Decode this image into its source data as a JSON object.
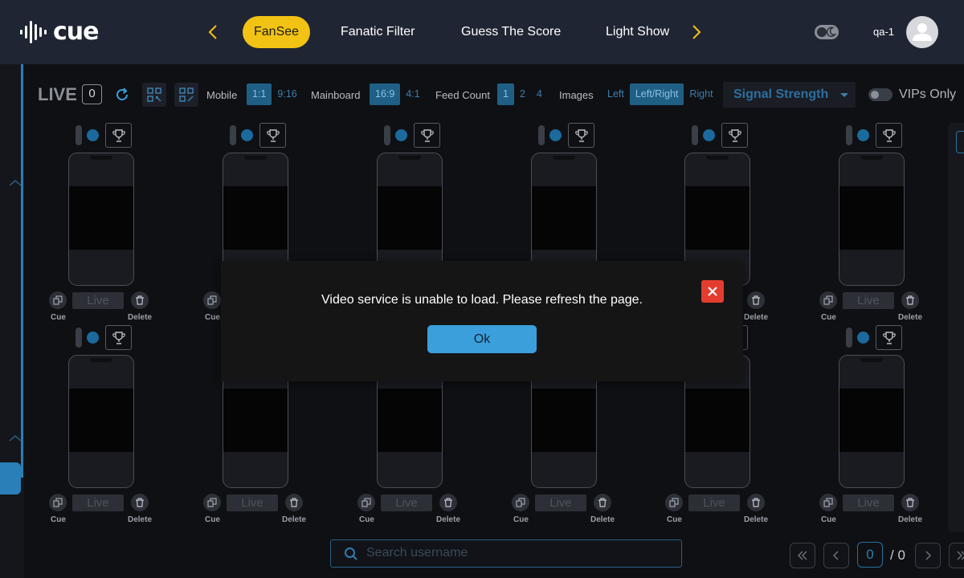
{
  "header": {
    "logo_text": "cue",
    "tabs": [
      {
        "label": "FanSee",
        "active": true
      },
      {
        "label": "Fanatic Filter",
        "active": false
      },
      {
        "label": "Guess The Score",
        "active": false
      },
      {
        "label": "Light Show",
        "active": false
      }
    ],
    "username": "qa-1",
    "icons": [
      "waveform-logo-icon",
      "chevron-left-icon",
      "chevron-right-icon",
      "moon-icon",
      "user-avatar-icon"
    ]
  },
  "toolbar": {
    "live_label": "LIVE",
    "live_count": "0",
    "mobile_label": "Mobile",
    "mobile_options": [
      "1:1",
      "9:16"
    ],
    "mobile_selected": "1:1",
    "mainboard_label": "Mainboard",
    "mainboard_options": [
      "16:9",
      "4:1"
    ],
    "mainboard_selected": "16:9",
    "feed_count_label": "Feed Count",
    "feed_count_options": [
      "1",
      "2",
      "4"
    ],
    "feed_count_selected": "1",
    "images_label": "Images",
    "images_options": [
      "Left",
      "Left/Right",
      "Right"
    ],
    "images_selected": "Left/Right",
    "sort_dropdown": "Signal Strength",
    "vips_only_label": "VIPs Only",
    "vips_only_on": false
  },
  "feed": {
    "live_label": "Live",
    "cue_label": "Cue",
    "delete_label": "Delete"
  },
  "search": {
    "placeholder": "Search username"
  },
  "pagination": {
    "current": "0",
    "total": "/ 0"
  },
  "modal": {
    "message": "Video service is unable to load. Please refresh the page.",
    "ok_label": "Ok"
  },
  "colors": {
    "header_bg": "#1f2532",
    "accent_yellow": "#f2c314",
    "accent_blue": "#3b9fdc",
    "close_red": "#e43d2f",
    "page_bg": "#0f1013"
  }
}
